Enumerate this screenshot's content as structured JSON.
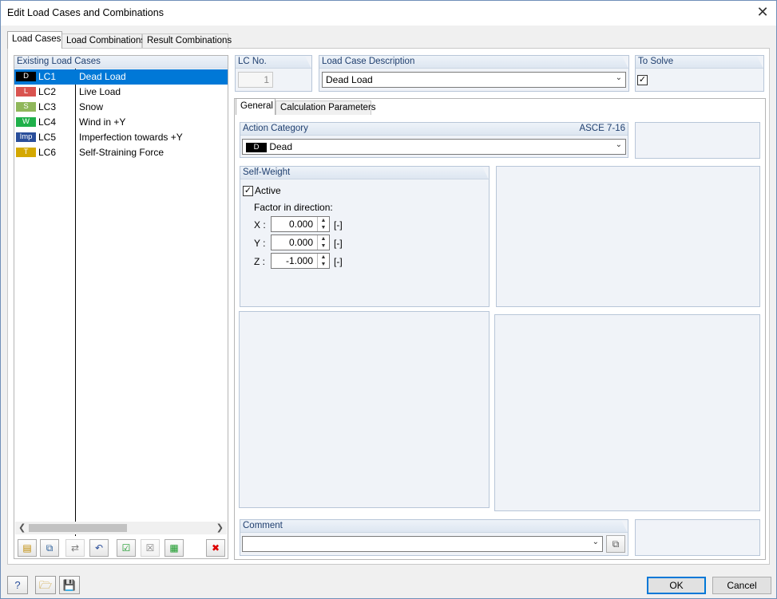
{
  "window": {
    "title": "Edit Load Cases and Combinations",
    "close": "✕"
  },
  "tabs": [
    "Load Cases",
    "Load Combinations",
    "Result Combinations"
  ],
  "list": {
    "header": "Existing Load Cases",
    "rows": [
      {
        "badge": "D",
        "badge_color": "#000000",
        "no": "LC1",
        "desc": "Dead Load"
      },
      {
        "badge": "L",
        "badge_color": "#d9534f",
        "no": "LC2",
        "desc": "Live Load"
      },
      {
        "badge": "S",
        "badge_color": "#8fb75a",
        "no": "LC3",
        "desc": "Snow"
      },
      {
        "badge": "W",
        "badge_color": "#1fb04a",
        "no": "LC4",
        "desc": "Wind in +Y"
      },
      {
        "badge": "Imp",
        "badge_color": "#2a4e9a",
        "no": "LC5",
        "desc": "Imperfection towards +Y"
      },
      {
        "badge": "T",
        "badge_color": "#d4a800",
        "no": "LC6",
        "desc": "Self-Straining Force"
      }
    ],
    "toolbar_icons": [
      "new-load-case-icon",
      "copy-load-case-icon",
      "renumber-icon",
      "generate-icon",
      "check-all-icon",
      "uncheck-all-icon",
      "select-to-solve-icon",
      "delete-icon"
    ]
  },
  "lc_no": {
    "label": "LC No.",
    "value": "1"
  },
  "description": {
    "label": "Load Case Description",
    "value": "Dead Load"
  },
  "to_solve": {
    "label": "To Solve",
    "checked": "✓"
  },
  "inner_tabs": [
    "General",
    "Calculation Parameters"
  ],
  "action_category": {
    "label": "Action Category",
    "standard": "ASCE 7-16",
    "badge": "D",
    "value": "Dead"
  },
  "self_weight": {
    "label": "Self-Weight",
    "active_label": "Active",
    "active_checked": "✓",
    "factor_label": "Factor in direction:",
    "factors": [
      {
        "axis": "X :",
        "value": "0.000",
        "unit": "[-]"
      },
      {
        "axis": "Y :",
        "value": "0.000",
        "unit": "[-]"
      },
      {
        "axis": "Z :",
        "value": "-1.000",
        "unit": "[-]"
      }
    ]
  },
  "comment": {
    "label": "Comment",
    "value": ""
  },
  "buttons": {
    "ok": "OK",
    "cancel": "Cancel"
  }
}
